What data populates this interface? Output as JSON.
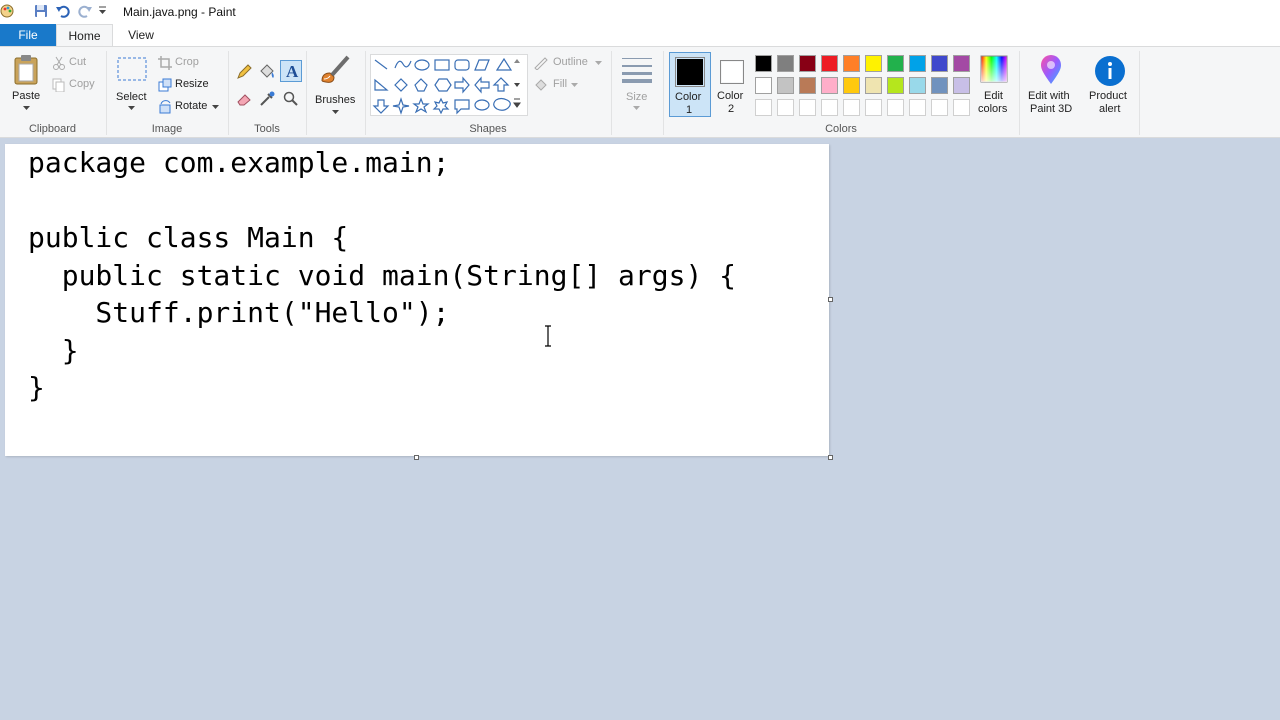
{
  "window": {
    "title": "Main.java.png - Paint"
  },
  "menu": {
    "file": "File",
    "home": "Home",
    "view": "View"
  },
  "clipboard": {
    "paste": "Paste",
    "cut": "Cut",
    "copy": "Copy",
    "group": "Clipboard"
  },
  "image": {
    "select": "Select",
    "crop": "Crop",
    "resize": "Resize",
    "rotate": "Rotate",
    "group": "Image"
  },
  "tools": {
    "group": "Tools"
  },
  "brushes": {
    "label": "Brushes"
  },
  "shapes": {
    "outline": "Outline",
    "fill": "Fill",
    "group": "Shapes"
  },
  "size": {
    "label": "Size"
  },
  "colors": {
    "color1_line1": "Color",
    "color1_line2": "1",
    "color2_line1": "Color",
    "color2_line2": "2",
    "group": "Colors",
    "edit_line1": "Edit",
    "edit_line2": "colors",
    "color1_value": "#000000",
    "color2_value": "#ffffff",
    "palette_row1": [
      "#000000",
      "#7f7f7f",
      "#880015",
      "#ed1c24",
      "#ff7f27",
      "#fff200",
      "#22b14c",
      "#00a2e8",
      "#3f48cc",
      "#a349a4"
    ],
    "palette_row2": [
      "#ffffff",
      "#c3c3c3",
      "#b97a57",
      "#ffaec9",
      "#ffc90e",
      "#efe4b0",
      "#b5e61d",
      "#99d9ea",
      "#7092be",
      "#c8bfe7"
    ],
    "palette_row3": [
      "#ffffff",
      "#ffffff",
      "#ffffff",
      "#ffffff",
      "#ffffff",
      "#ffffff",
      "#ffffff",
      "#ffffff",
      "#ffffff",
      "#ffffff"
    ]
  },
  "paint3d": {
    "line1": "Edit with",
    "line2": "Paint 3D"
  },
  "alert": {
    "line1": "Product",
    "line2": "alert"
  },
  "canvas": {
    "code_lines": [
      "package com.example.main;",
      "",
      "public class Main {",
      "  public static void main(String[] args) {",
      "    Stuff.print(\"Hello\");",
      "  }",
      "}"
    ]
  },
  "accent": "#1979ca",
  "canvas_background": "#c8d3e3"
}
